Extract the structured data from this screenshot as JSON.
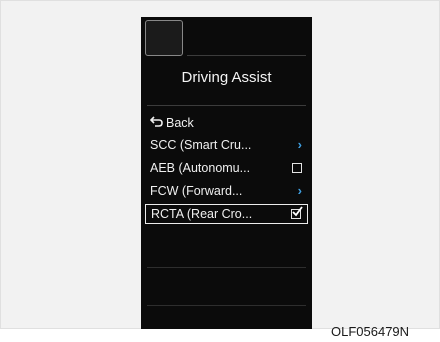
{
  "screen": {
    "title": "Driving Assist",
    "menu": [
      {
        "label": "Back",
        "control": "back-icon"
      },
      {
        "label": "SCC (Smart Cru...",
        "control": "chevron-right-icon"
      },
      {
        "label": "AEB (Autonomu...",
        "control": "checkbox-unchecked"
      },
      {
        "label": "FCW (Forward...",
        "control": "chevron-right-icon"
      },
      {
        "label": "RCTA (Rear Cro...",
        "control": "checkbox-checked",
        "selected": true
      }
    ]
  },
  "caption": "OLF056479N",
  "colors": {
    "screen_bg": "#0b0b0b",
    "text": "#f0f0f0",
    "chevron_accent": "#3f9fe0",
    "frame_bg": "#f2f2f2"
  }
}
